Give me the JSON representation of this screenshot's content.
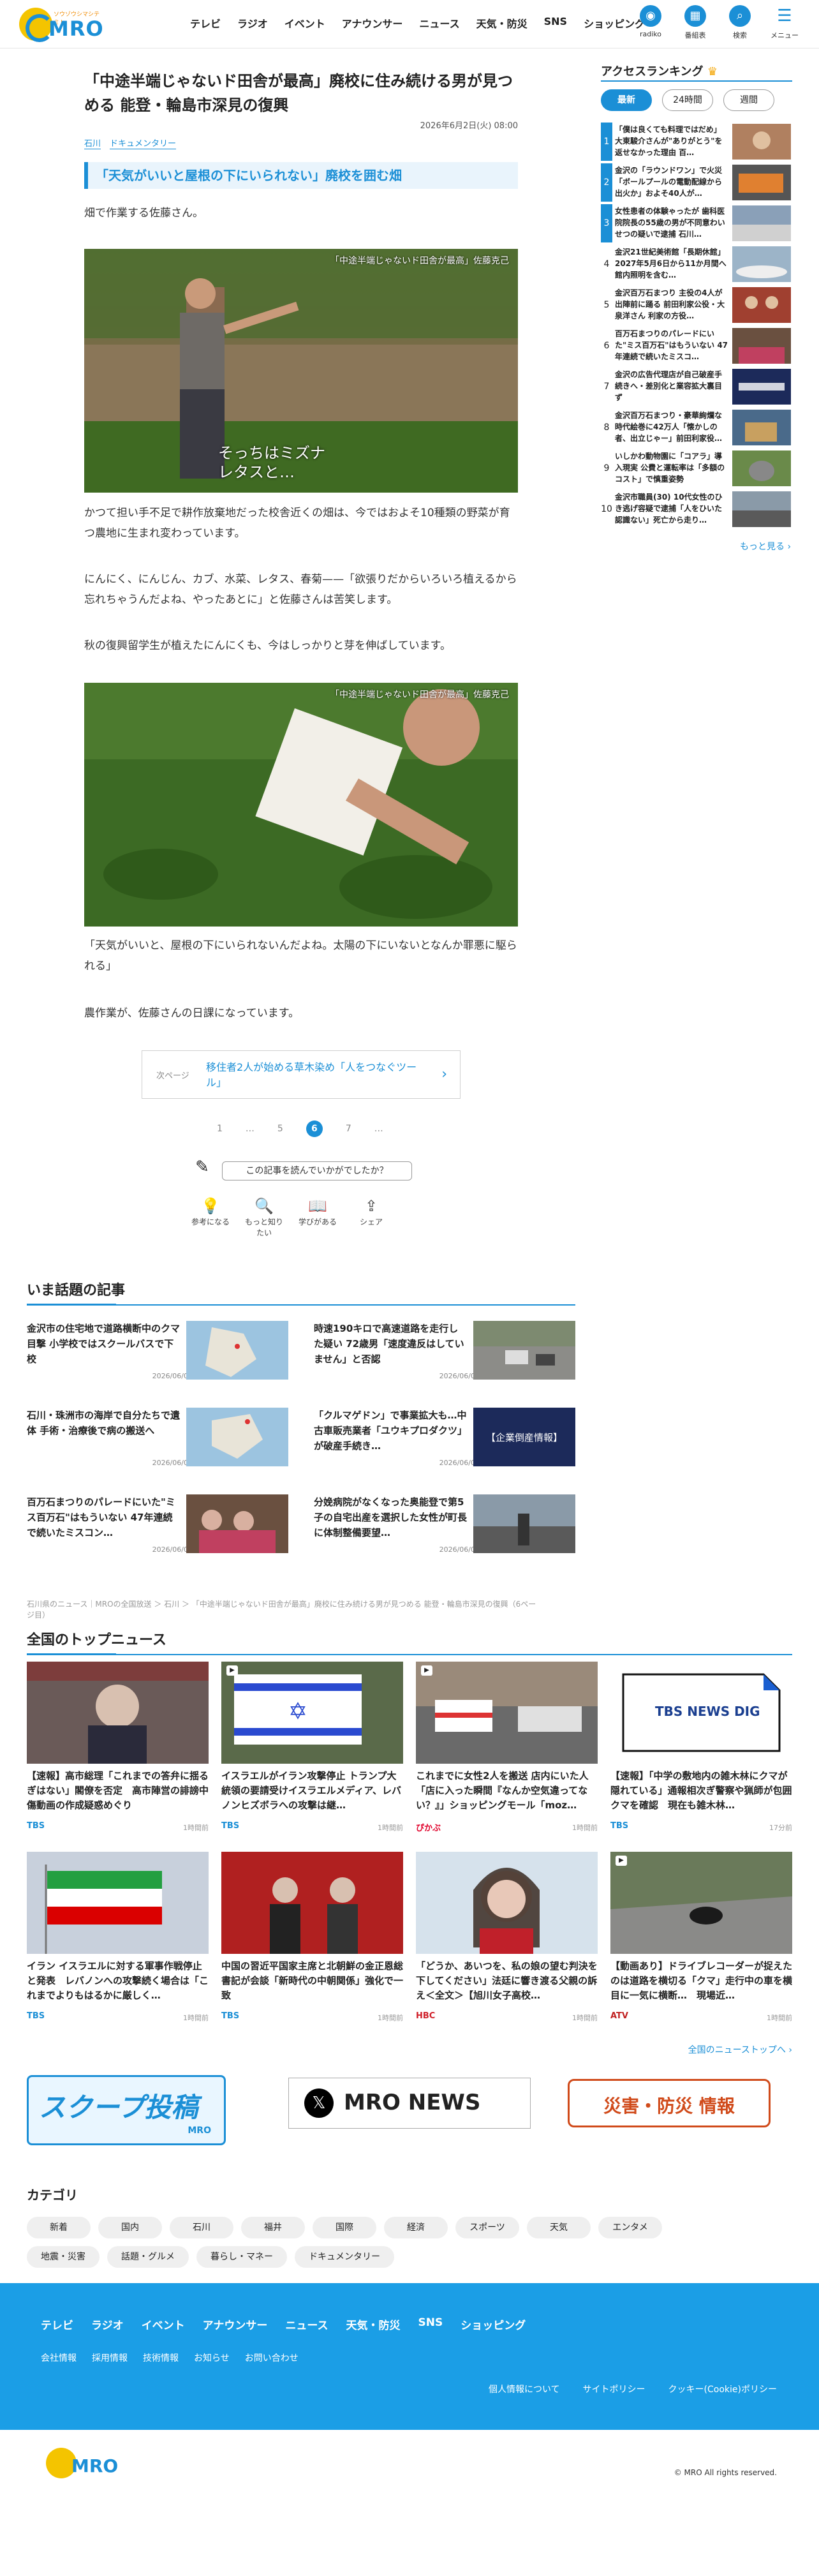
{
  "header": {
    "logo_text": "MRO",
    "logo_sub": "ソウゾウシマシテミト",
    "nav": [
      "テレビ",
      "ラジオ",
      "イベント",
      "アナウンサー",
      "ニュース",
      "天気・防災",
      "SNS",
      "ショッピング"
    ],
    "icons": [
      {
        "label": "radiko",
        "icon": "radiko-icon"
      },
      {
        "label": "番組表",
        "icon": "tv-guide-icon"
      },
      {
        "label": "検索",
        "icon": "search-icon"
      },
      {
        "label": "メニュー",
        "icon": "menu-icon"
      }
    ]
  },
  "article": {
    "title": "「中途半端じゃないド田舎が最高」廃校に住み続ける男が見つめる 能登・輪島市深見の復興",
    "date": "2026年6月2日(火) 08:00",
    "tags": [
      "石川",
      "ドキュメンタリー"
    ],
    "subheading": "「天気がいいと屋根の下にいられない」廃校を囲む畑",
    "p1": "畑で作業する佐藤さん。",
    "photo1_caption": "「中途半端じゃないド田舎が最高」佐藤克己",
    "photo1_subtitle": "そっちはミズナ\nレタスと…",
    "p2": "かつて担い手不足で耕作放棄地だった校舎近くの畑は、今ではおよそ10種類の野菜が育つ農地に生まれ変わっています。",
    "p3": "にんにく、にんじん、カブ、水菜、レタス、春菊——「欲張りだからいろいろ植えるから忘れちゃうんだよね、やったあとに」と佐藤さんは苦笑します。",
    "p4": "秋の復興留学生が植えたにんにくも、今はしっかりと芽を伸ばしています。",
    "photo2_caption": "「中途半端じゃないド田舎が最高」佐藤克己",
    "p5": "「天気がいいと、屋根の下にいられないんだよね。太陽の下にいないとなんか罪悪に駆られる」",
    "p6": "農作業が、佐藤さんの日課になっています。",
    "next_label": "次ページ",
    "next_title": "移住者2人が始める草木染め「人をつなぐツール」",
    "pager": [
      "1",
      "…",
      "5",
      "6",
      "7",
      "…"
    ],
    "pager_current": "6",
    "feedback": "この記事を読んでいかがでしたか？",
    "reactions": [
      {
        "label": "参考になる",
        "icon": "lightbulb-icon",
        "glyph": "💡"
      },
      {
        "label": "もっと知りたい",
        "icon": "magnifier-icon",
        "glyph": "🔍"
      },
      {
        "label": "学びがある",
        "icon": "book-icon",
        "glyph": "📖"
      },
      {
        "label": "シェア",
        "icon": "share-icon",
        "glyph": "⇪"
      }
    ]
  },
  "topics": {
    "heading": "いま話題の記事",
    "items": [
      {
        "text": "金沢市の住宅地で道路横断中のクマ目撃 小学校ではスクールバスで下校",
        "date": "2026/06/01"
      },
      {
        "text": "時速190キロで高速道路を走行した疑い 72歳男「速度違反はしていません」と否認",
        "date": "2026/06/02"
      },
      {
        "text": "石川・珠洲市の海岸で自分たちで遺体 手術・治療後で病の搬送へ",
        "date": "2026/06/01"
      },
      {
        "text": "「クルマゲドン」で事業拡大も…中古車販売業者「ユウキプロダクツ」が破産手続き…",
        "date": "2026/06/02"
      },
      {
        "text": "百万石まつりのパレードにいた\"ミス百万石\"はもういない 47年連続で続いたミスコン…",
        "date": "2026/06/01"
      },
      {
        "text": "分娩病院がなくなった奥能登で第5子の自宅出産を選択した女性が町長に体制整備要望…",
        "date": "2026/06/02"
      }
    ]
  },
  "breadcrumb": "石川県のニュース｜MROの全国放送 ＞ 石川 ＞ 「中途半端じゃないド田舎が最高」廃校に住み続ける男が見つめる 能登・輪島市深見の復興（6ページ目）",
  "national": {
    "heading": "全国のトップニュース",
    "items": [
      {
        "title": "【速報】高市総理「これまでの答弁に揺るぎはない」閣僚を否定　高市陣営の誹謗中傷動画の作成疑惑めぐり",
        "src": "TBS",
        "ago": "1時間前"
      },
      {
        "title": "イスラエルがイラン攻撃停止 トランプ大統領の要請受けイスラエルメディア、レバノンヒズボラへの攻撃は継…",
        "src": "TBS",
        "ago": "1時間前"
      },
      {
        "title": "これまでに女性2人を搬送 店内にいた人「店に入った瞬間『なんか空気違ってない？』」ショッピングモール「moz…",
        "src": "ぴかぶ",
        "ago": "1時間前"
      },
      {
        "title": "【速報】「中学の敷地内の雑木林にクマが隠れている」通報相次ぎ警察や猟師が包囲　クマを確認　現在も雑木林…",
        "src": "TBS",
        "ago": "17分前"
      },
      {
        "title": "イラン イスラエルに対する軍事作戦停止と発表　レバノンへの攻撃続く場合は「これまでよりもはるかに厳しく…",
        "src": "TBS",
        "ago": "1時間前"
      },
      {
        "title": "中国の習近平国家主席と北朝鮮の金正恩総書記が会談「新時代の中朝関係」強化で一致",
        "src": "TBS",
        "ago": "1時間前"
      },
      {
        "title": "「どうか、あいつを、私の娘の望む判決を下してください」法廷に響き渡る父親の訴え＜全文＞【旭川女子高校…",
        "src": "HBC",
        "ago": "1時間前"
      },
      {
        "title": "【動画あり】ドライブレコーダーが捉えたのは道路を横切る「クマ」走行中の車を横目に一気に横断…　現場近…",
        "src": "ATV",
        "ago": "1時間前"
      }
    ],
    "more": "全国のニューストップへ",
    "tbs_card": "TBS NEWS DIG"
  },
  "banners": {
    "scoop": "スクープ投稿",
    "scoop_sub": "MRO",
    "xnews": "MRO NEWS",
    "disaster": "災害・防災 情報"
  },
  "categories": {
    "heading": "カテゴリ",
    "items": [
      "新着",
      "国内",
      "石川",
      "福井",
      "国際",
      "経済",
      "スポーツ",
      "天気",
      "エンタメ",
      "地震・災害",
      "話題・グルメ",
      "暮らし・マネー",
      "ドキュメンタリー"
    ]
  },
  "footer": {
    "nav": [
      "テレビ",
      "ラジオ",
      "イベント",
      "アナウンサー",
      "ニュース",
      "天気・防災",
      "SNS",
      "ショッピング"
    ],
    "nav2": [
      "会社情報",
      "採用情報",
      "技術情報",
      "お知らせ",
      "お問い合わせ"
    ],
    "nav3": [
      "個人情報について",
      "サイトポリシー",
      "クッキー(Cookie)ポリシー"
    ],
    "copyright": "© MRO All rights reserved."
  },
  "sidebar": {
    "heading": "アクセスランキング",
    "tabs": [
      "最新",
      "24時間",
      "週間"
    ],
    "items": [
      {
        "n": "1",
        "text": "「僕は良くても料理ではだめ」大東駿介さんが\"ありがとう\"を返せなかった理由 百…"
      },
      {
        "n": "2",
        "text": "金沢の「ラウンドワン」で火災「ボールプールの電動配線から出火か」およそ40人が…"
      },
      {
        "n": "3",
        "text": "女性患者の体験ゃったが 歯科医院院長の55歳の男が不同意わいせつの疑いで逮捕 石川…"
      },
      {
        "n": "4",
        "text": "金沢21世紀美術館「長期休館」2027年5月6日から11か月間へ 館内照明を含む…"
      },
      {
        "n": "5",
        "text": "金沢百万石まつり 主役の4人が出陣前に踊る 前田利家公役・大泉洋さん 利家の方役…"
      },
      {
        "n": "6",
        "text": "百万石まつりのパレードにいた\"ミス百万石\"はもういない 47年連続で続いたミスコ…"
      },
      {
        "n": "7",
        "text": "金沢の広告代理店が自己破産手続きへ・差別化と業容拡大裏目ず"
      },
      {
        "n": "8",
        "text": "金沢百万石まつり・豪華絢爛な時代絵巻に42万人「懐かしの者、出立じゃー」前田利家役…"
      },
      {
        "n": "9",
        "text": "いしかわ動物園に「コアラ」導入現実 公費と運転率は「多額のコスト」で慎重姿勢"
      },
      {
        "n": "10",
        "text": "金沢市職員(30) 10代女性のひき逃げ容疑で逮捕「人をひいた認識ない」死亡から走り…"
      }
    ],
    "more": "もっと見る"
  }
}
